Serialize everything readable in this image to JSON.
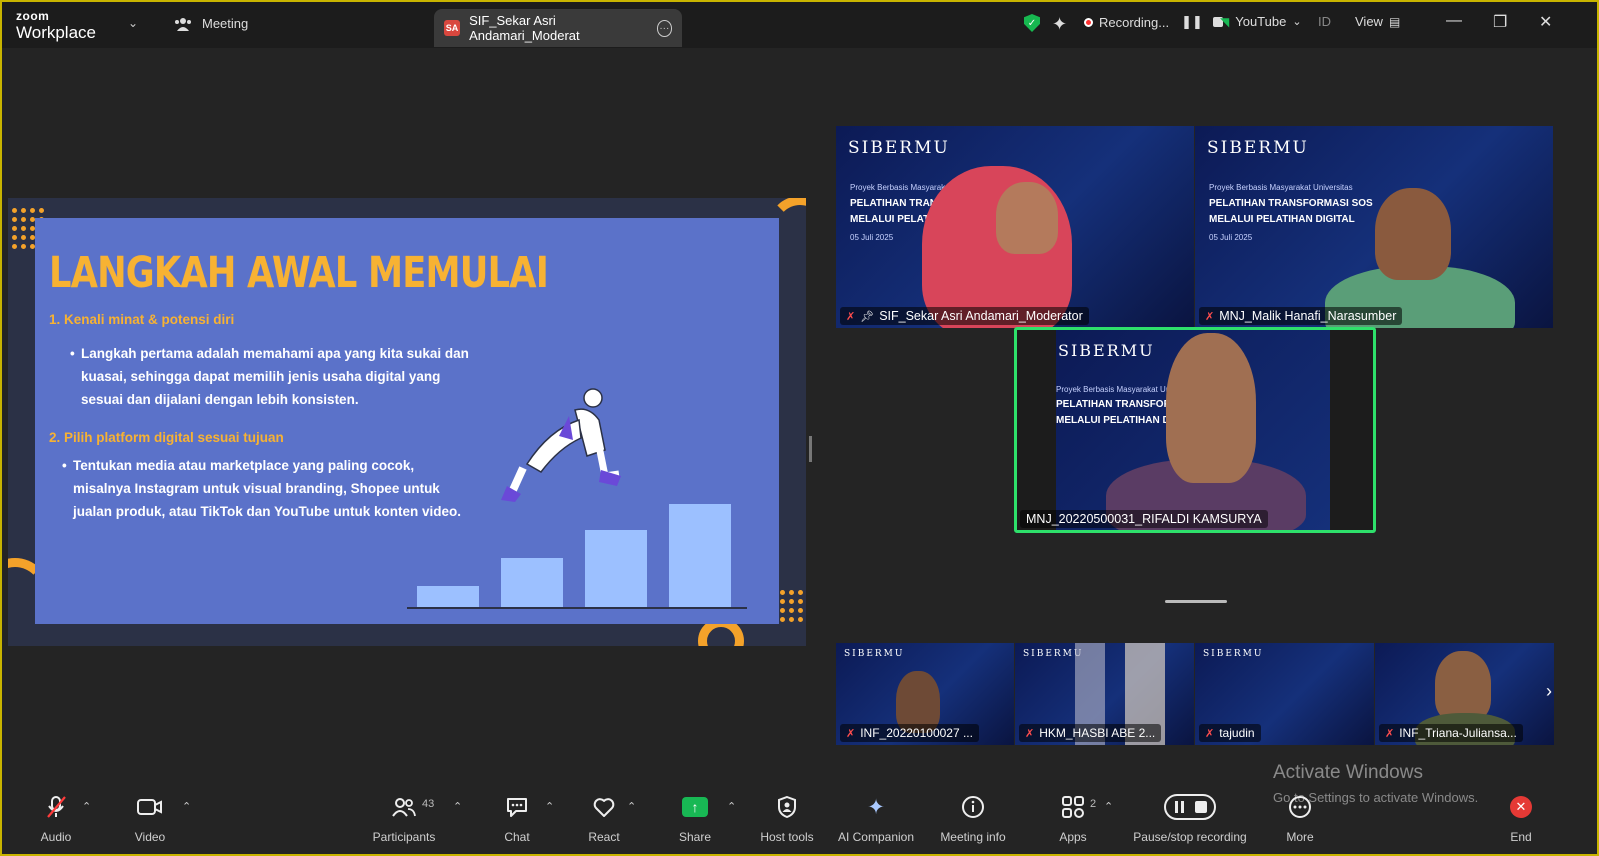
{
  "titlebar": {
    "brand_top": "zoom",
    "brand_bottom": "Workplace",
    "meeting_label": "Meeting",
    "active_tab_badge": "SA",
    "active_tab_label": "SIF_Sekar Asri Andamari_Moderat",
    "recording_label": "Recording...",
    "youtube_label": "YouTube",
    "id_label": "ID",
    "view_label": "View"
  },
  "slide": {
    "title": "LANGKAH AWAL MEMULAI",
    "heading1": "1. Kenali minat & potensi diri",
    "bullet1_lines": [
      "Langkah pertama adalah memahami apa yang kita sukai dan",
      "kuasai, sehingga dapat memilih jenis usaha digital yang",
      "sesuai dan dijalani dengan lebih konsisten."
    ],
    "heading2": "2. Pilih platform digital sesuai tujuan",
    "bullet2_lines": [
      "Tentukan media atau marketplace yang paling cocok,",
      "misalnya Instagram untuk visual branding, Shopee untuk",
      "jualan produk, atau TikTok dan YouTube untuk konten video."
    ]
  },
  "background_text": {
    "logo": "SIBERMU",
    "subtitle": "Proyek Berbasis Masyarakat Universitas",
    "line1": "PELATIHAN TRANSFORMASI SOS",
    "line2": "MELALUI PELATIHAN DIGITAL",
    "date": "05 Juli 2025"
  },
  "participants_main": [
    {
      "name": "SIF_Sekar Asri Andamari_Moderator",
      "muted": true,
      "pinned": true
    },
    {
      "name": "MNJ_Malik Hanafi_Narasumber",
      "muted": true,
      "pinned": false
    },
    {
      "name": "MNJ_20220500031_RIFALDI KAMSURYA",
      "muted": false,
      "speaking": true
    }
  ],
  "participants_strip": [
    {
      "name": "INF_20220100027 ...",
      "muted": true
    },
    {
      "name": "HKM_HASBI ABE  2...",
      "muted": true
    },
    {
      "name": "tajudin",
      "muted": true
    },
    {
      "name": "INF_Triana-Juliansa...",
      "muted": true
    }
  ],
  "toolbar": {
    "audio": "Audio",
    "video": "Video",
    "participants": "Participants",
    "participants_count": "43",
    "chat": "Chat",
    "react": "React",
    "share": "Share",
    "host_tools": "Host tools",
    "ai_companion": "AI Companion",
    "meeting_info": "Meeting info",
    "apps": "Apps",
    "apps_count": "2",
    "pause_stop_recording": "Pause/stop recording",
    "more": "More",
    "end": "End"
  },
  "watermark": {
    "line1": "Activate Windows",
    "line2": "Go to Settings to activate Windows."
  },
  "colors": {
    "accent_green": "#2ee06b",
    "slide_bg": "#5b72c9",
    "slide_title": "#f7b233",
    "mic_off": "#ff4d4d"
  }
}
